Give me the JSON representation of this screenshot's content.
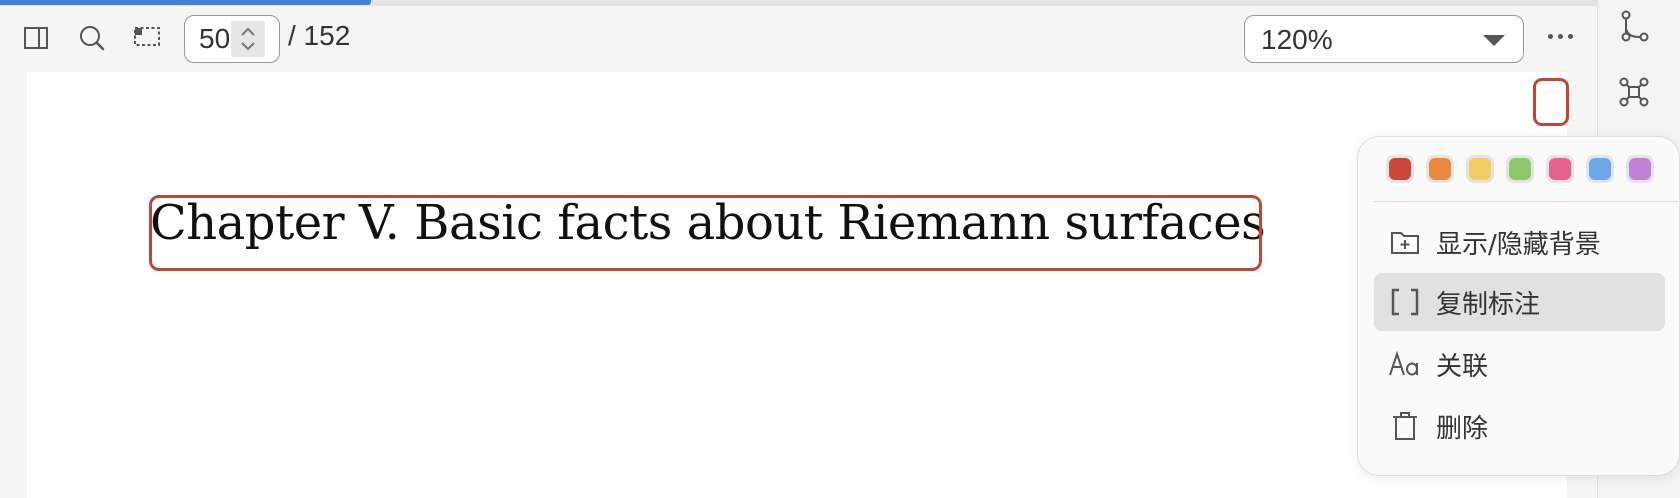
{
  "toolbar": {
    "page_input_value": "50",
    "page_total": "/ 152",
    "zoom_value": "120%"
  },
  "document": {
    "chapter_title": "Chapter V. Basic facts about Riemann surfaces"
  },
  "context_menu": {
    "swatches": [
      {
        "name": "red",
        "color": "#c9463a"
      },
      {
        "name": "orange",
        "color": "#e8893d"
      },
      {
        "name": "yellow",
        "color": "#f3cb64"
      },
      {
        "name": "green",
        "color": "#8dc96a"
      },
      {
        "name": "pink",
        "color": "#e8618a"
      },
      {
        "name": "blue",
        "color": "#6ea6ea"
      },
      {
        "name": "purple",
        "color": "#c082d8"
      }
    ],
    "items": [
      {
        "label": "显示/隐藏背景",
        "icon": "folder-plus-icon"
      },
      {
        "label": "复制标注",
        "icon": "brackets-icon",
        "active": true
      },
      {
        "label": "关联",
        "icon": "text-aa-icon"
      },
      {
        "label": "删除",
        "icon": "trash-icon"
      }
    ]
  },
  "colors": {
    "accent": "#4a7fd6",
    "annotation_border": "#c0463a"
  }
}
